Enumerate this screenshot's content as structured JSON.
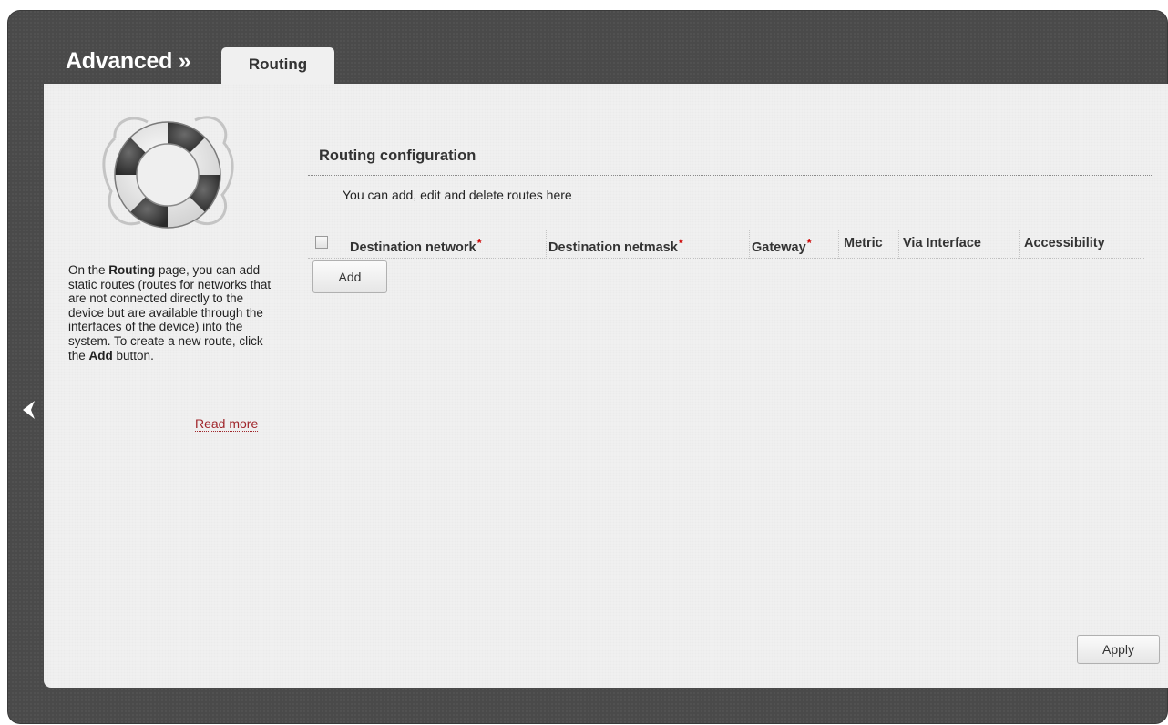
{
  "header": {
    "title": "Advanced »",
    "tab_label": "Routing"
  },
  "help": {
    "icon": "lifebuoy-icon",
    "text_parts": [
      "On the ",
      "Routing",
      " page, you can add static routes (routes for networks that are not connected directly to the device but are available through the interfaces of the device) into the system. To create a new route, click the ",
      "Add",
      " button."
    ],
    "read_more": "Read more"
  },
  "section": {
    "title": "Routing configuration",
    "description": "You can add, edit and delete routes here"
  },
  "table": {
    "columns": [
      {
        "label": "Destination network",
        "required": "*"
      },
      {
        "label": "Destination netmask",
        "required": "*"
      },
      {
        "label": "Gateway",
        "required": "*"
      },
      {
        "label": "Metric",
        "required": ""
      },
      {
        "label": "Via Interface",
        "required": ""
      },
      {
        "label": "Accessibility",
        "required": ""
      }
    ],
    "rows": []
  },
  "buttons": {
    "add": "Add",
    "apply": "Apply"
  },
  "colors": {
    "frame": "#4a4a4a",
    "panel": "#f0f0f0",
    "required": "#cc0000",
    "link": "#a0262b"
  }
}
